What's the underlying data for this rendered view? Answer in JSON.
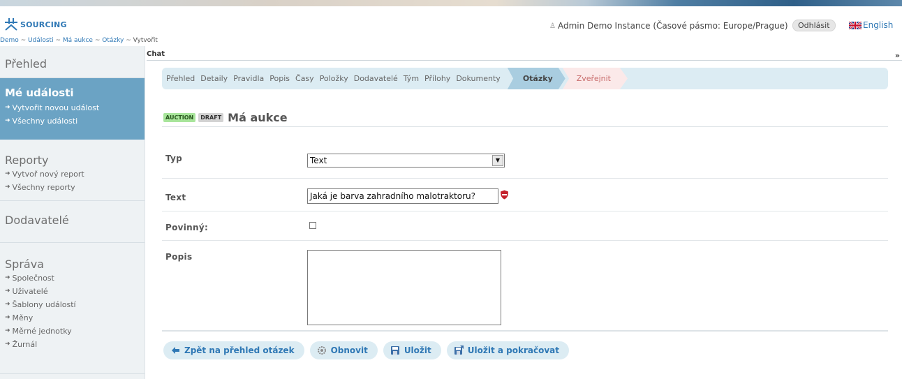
{
  "header": {
    "logo_text": "SOURCING",
    "user_label": "Admin Demo Instance (Časové pásmo: Europe/Prague)",
    "logout_label": "Odhlásit",
    "language_label": "English"
  },
  "breadcrumb": {
    "items": [
      "Demo",
      "Události",
      "Má aukce",
      "Otázky"
    ],
    "separator": "~",
    "current": "Vytvořit"
  },
  "sidebar": {
    "prehled": "Přehled",
    "my_events": {
      "title": "Mé události",
      "links": [
        "Vytvořit novou událost",
        "Všechny události"
      ]
    },
    "reports": {
      "title": "Reporty",
      "links": [
        "Vytvoř nový report",
        "Všechny reporty"
      ]
    },
    "suppliers": "Dodavatelé",
    "admin": {
      "title": "Správa",
      "links": [
        "Společnost",
        "Uživatelé",
        "Šablony událostí",
        "Měny",
        "Měrné jednotky",
        "Žurnál"
      ]
    }
  },
  "chat": {
    "label": "Chat",
    "toggle": "»"
  },
  "steps": {
    "items": [
      "Přehled",
      "Detaily",
      "Pravidla",
      "Popis",
      "Časy",
      "Položky",
      "Dodavatelé",
      "Tým",
      "Přílohy",
      "Dokumenty"
    ],
    "active": "Otázky",
    "next": "Zveřejnit"
  },
  "event": {
    "badge_type": "AUCTION",
    "badge_status": "DRAFT",
    "title": "Má aukce"
  },
  "form": {
    "type_label": "Typ",
    "type_value": "Text",
    "text_label": "Text",
    "text_value": "Jaká je barva zahradního malotraktoru?",
    "required_label": "Povinný:",
    "required_checked": false,
    "description_label": "Popis",
    "description_value": ""
  },
  "buttons": {
    "back": "Zpět na přehled otázek",
    "refresh": "Obnovit",
    "save": "Uložit",
    "save_continue": "Uložit a pokračovat"
  },
  "colors": {
    "accent": "#2f78b5",
    "sidebar_active": "#6ba3c4",
    "steps_bg": "#dcecf3",
    "step_active": "#a9cde0",
    "step_next": "#fbe9e9"
  }
}
